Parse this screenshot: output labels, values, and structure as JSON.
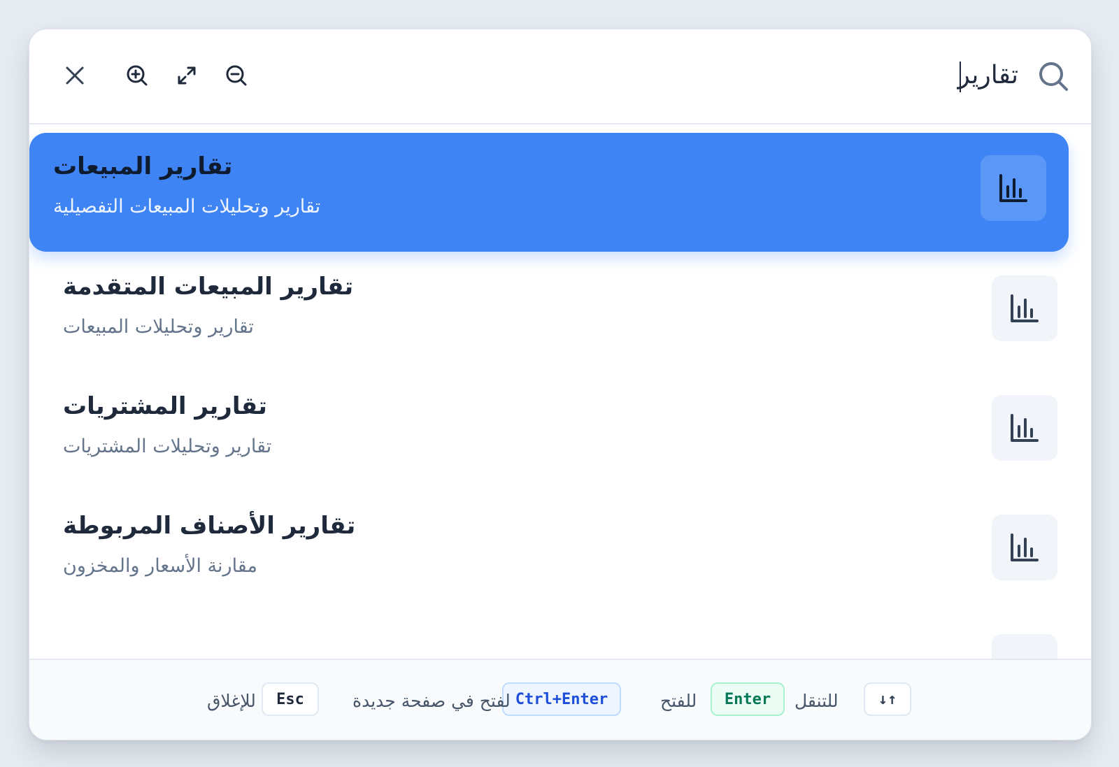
{
  "search": {
    "query": "تقارير"
  },
  "toolbar": {
    "close": "close-icon",
    "zoom_in": "zoom-in-icon",
    "expand": "expand-icon",
    "zoom_out": "zoom-out-icon"
  },
  "results": [
    {
      "title": "تقارير المبيعات",
      "subtitle": "تقارير وتحليلات المبيعات التفصيلية",
      "icon": "bar-chart-icon",
      "active": true
    },
    {
      "title": "تقارير المبيعات المتقدمة",
      "subtitle": "تقارير وتحليلات المبيعات",
      "icon": "bar-chart-icon",
      "active": false
    },
    {
      "title": "تقارير المشتريات",
      "subtitle": "تقارير وتحليلات المشتريات",
      "icon": "bar-chart-icon",
      "active": false
    },
    {
      "title": "تقارير الأصناف المربوطة",
      "subtitle": "مقارنة الأسعار والمخزون",
      "icon": "bar-chart-icon",
      "active": false
    }
  ],
  "footer": {
    "nav_key": "↓↑",
    "nav_label": "للتنقل",
    "enter_key": "Enter",
    "enter_label": "للفتح",
    "ctrl_key": "Ctrl+Enter",
    "ctrl_label": "لفتح في صفحة جديدة",
    "esc_key": "Esc",
    "esc_label": "للإغلاق"
  },
  "colors": {
    "accent": "#3f84f4",
    "enter": "#047857",
    "ctrl": "#1d4ed8"
  }
}
